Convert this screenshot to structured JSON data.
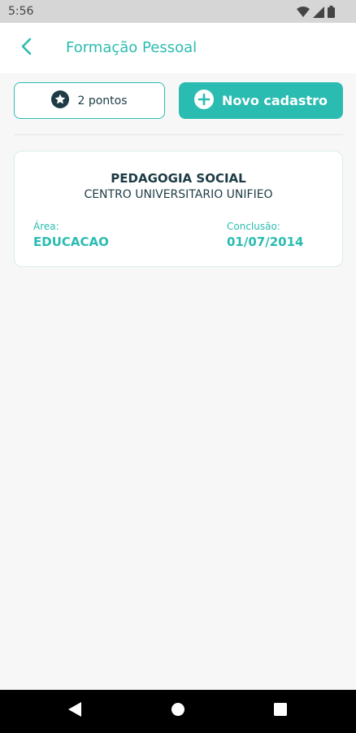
{
  "status_bar": {
    "time": "5:56",
    "icons": [
      "wifi-icon",
      "signal-icon",
      "battery-icon"
    ]
  },
  "app_bar": {
    "title": "Formação Pessoal",
    "back_icon": "chevron-left-icon"
  },
  "actions": {
    "points_label": "2 pontos",
    "points_icon": "star-badge-icon",
    "new_label": "Novo cadastro",
    "new_icon": "plus-circle-icon"
  },
  "records": [
    {
      "course": "PEDAGOGIA SOCIAL",
      "institution": "CENTRO UNIVERSITARIO UNIFIEO",
      "area_label": "Área:",
      "area_value": "EDUCACAO",
      "conclusion_label": "Conclusão:",
      "conclusion_value": "01/07/2014"
    }
  ],
  "nav_bar": {
    "icons": [
      "back-triangle-icon",
      "home-circle-icon",
      "recents-square-icon"
    ]
  },
  "colors": {
    "accent": "#2bbcb1",
    "text_dark": "#1d3b45",
    "background": "#f7f7f7"
  }
}
